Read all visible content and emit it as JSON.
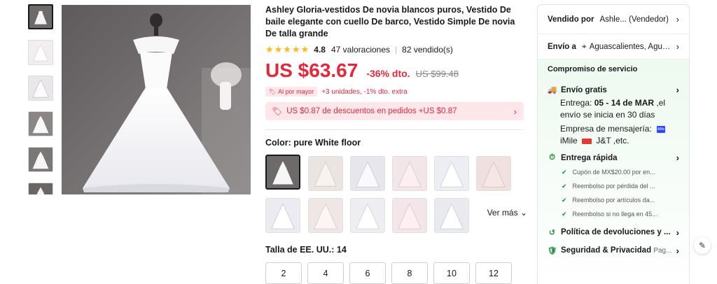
{
  "product": {
    "title": "Ashley Gloria-vestidos De novia blancos puros, Vestido De baile elegante con cuello De barco, Vestido Simple De novia De talla grande",
    "stars": "★★★★★",
    "rating": "4.8",
    "reviews": "47 valoraciones",
    "separator": "|",
    "sold": "82 vendido(s)",
    "price": "US $63.67",
    "discount": "-36% dto.",
    "old_price": "US $99.48",
    "bulk_tag": "Al por mayor",
    "bulk_text": "+3 unidades, -1% dto. extra",
    "coupon_text": "US $0.87 de descuentos en pedidos +US $0.87",
    "color_label": "Color: pure White floor",
    "more_label": "Ver más",
    "size_label": "Talla de EE. UU.: 14",
    "sizes": [
      "2",
      "4",
      "6",
      "8",
      "10",
      "12"
    ]
  },
  "panel": {
    "sold_by_label": "Vendido por",
    "sold_by_value": "Ashle... (Vendedor)",
    "ship_to_label": "Envío a",
    "ship_to_value": "Aguascalientes, Agua...",
    "service_title": "Compromiso de servicio",
    "free_shipping": "Envío gratis",
    "delivery_prefix": "Entrega: ",
    "delivery_dates": "05 - 14 de MAR",
    "delivery_suffix": " ,el envío se inicia en 30 días",
    "carrier_label": "Empresa de mensajería:",
    "carrier_logo": "iMile",
    "carriers": "iMile",
    "carriers_rest": "J&T ,etc.",
    "fast_delivery": "Entrega rápida",
    "fast_checks": [
      "Cupón de MX$20.00 por en...",
      "Reembolso por pérdida del ...",
      "Reembolso por artículos da...",
      "Reembolso si no llega en 45..."
    ],
    "returns": "Política de devoluciones y ...",
    "security": "Seguridad & Privacidad",
    "security_sub": "Pag..."
  },
  "icons": {
    "chevron": "›",
    "check": "✔",
    "pin": "⌖",
    "edit": "✎"
  },
  "colors": {
    "accent_red": "#e5273c",
    "star_yellow": "#fdb817",
    "service_green": "#1e8a3a"
  }
}
